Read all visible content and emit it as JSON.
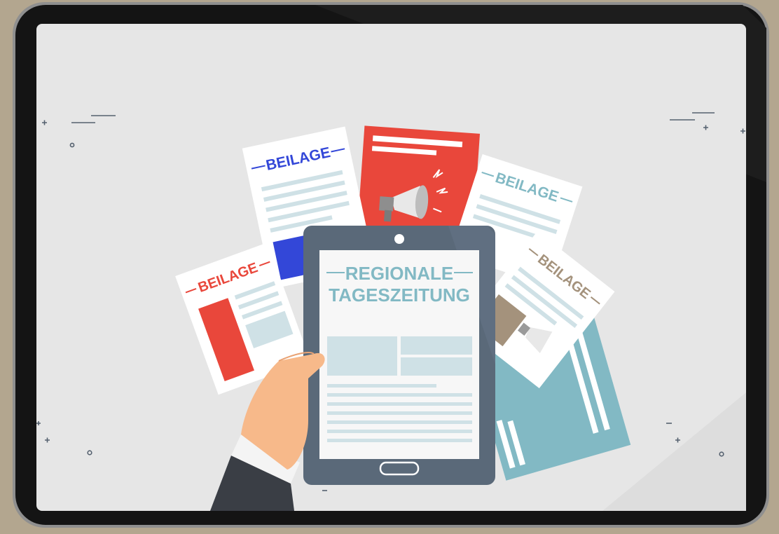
{
  "illustration": {
    "tablet_title_line1": "REGIONALE",
    "tablet_title_line2": "TAGESZEITUNG",
    "insert_labels": {
      "blue": "BEILAGE",
      "red": "BEILAGE",
      "teal": "BEILAGE",
      "tan": "BEILAGE"
    }
  },
  "colors": {
    "background_frame": "#b3a68f",
    "device_bezel": "#141414",
    "screen": "#e6e6e6",
    "tablet_body": "#5a6979",
    "accent_red": "#e9473b",
    "accent_blue": "#3347d8",
    "accent_teal": "#82b9c4",
    "accent_tan": "#a4927c",
    "skin": "#f7b98a"
  }
}
